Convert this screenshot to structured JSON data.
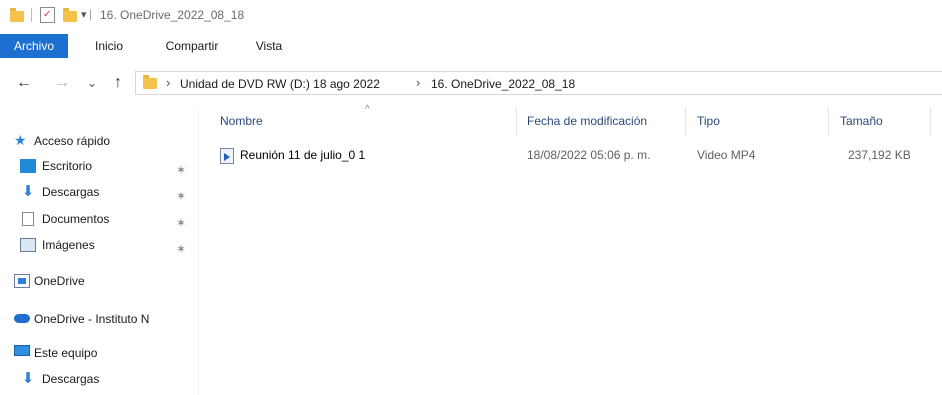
{
  "window": {
    "title": "16. OneDrive_2022_08_18",
    "quick_access_toolbar_glyph": "▾",
    "title_separator": "|"
  },
  "ribbon": {
    "tabs": [
      {
        "label": "Archivo",
        "active": true
      },
      {
        "label": "Inicio"
      },
      {
        "label": "Compartir"
      },
      {
        "label": "Vista"
      }
    ]
  },
  "navigation": {
    "back_glyph": "←",
    "forward_glyph": "→",
    "recent_glyph": "⌄",
    "up_glyph": "↑"
  },
  "address": {
    "separator_glyph": "›",
    "crumbs": [
      "Unidad de DVD RW (D:) 18 ago 2022",
      "16. OneDrive_2022_08_18"
    ]
  },
  "sidebar": {
    "pin_glyph": "📌",
    "items": [
      {
        "label": "Acceso rápido",
        "icon": "star-icon"
      },
      {
        "label": "Escritorio",
        "icon": "desktop-icon",
        "pinned": true
      },
      {
        "label": "Descargas",
        "icon": "download-icon",
        "pinned": true
      },
      {
        "label": "Documentos",
        "icon": "document-icon",
        "pinned": true
      },
      {
        "label": "Imágenes",
        "icon": "image-icon",
        "pinned": true
      },
      {
        "label": "OneDrive",
        "icon": "onedrive-folder-icon"
      },
      {
        "label": "OneDrive - Instituto N",
        "icon": "cloud-icon"
      },
      {
        "label": "Este equipo",
        "icon": "computer-icon"
      },
      {
        "label": "Descargas",
        "icon": "download-icon"
      }
    ]
  },
  "columns": {
    "name": "Nombre",
    "modified": "Fecha de modificación",
    "type": "Tipo",
    "size": "Tamaño",
    "sort_glyph": "^"
  },
  "files": [
    {
      "name": "Reunión 11 de julio_0 1",
      "modified": "18/08/2022 05:06 p. m.",
      "type": "Video MP4",
      "size": "237,192 KB",
      "icon": "video-file-icon"
    }
  ],
  "colors": {
    "accent": "#1d6fd0",
    "folder": "#f4c24a",
    "header_text": "#2a4a7a"
  }
}
